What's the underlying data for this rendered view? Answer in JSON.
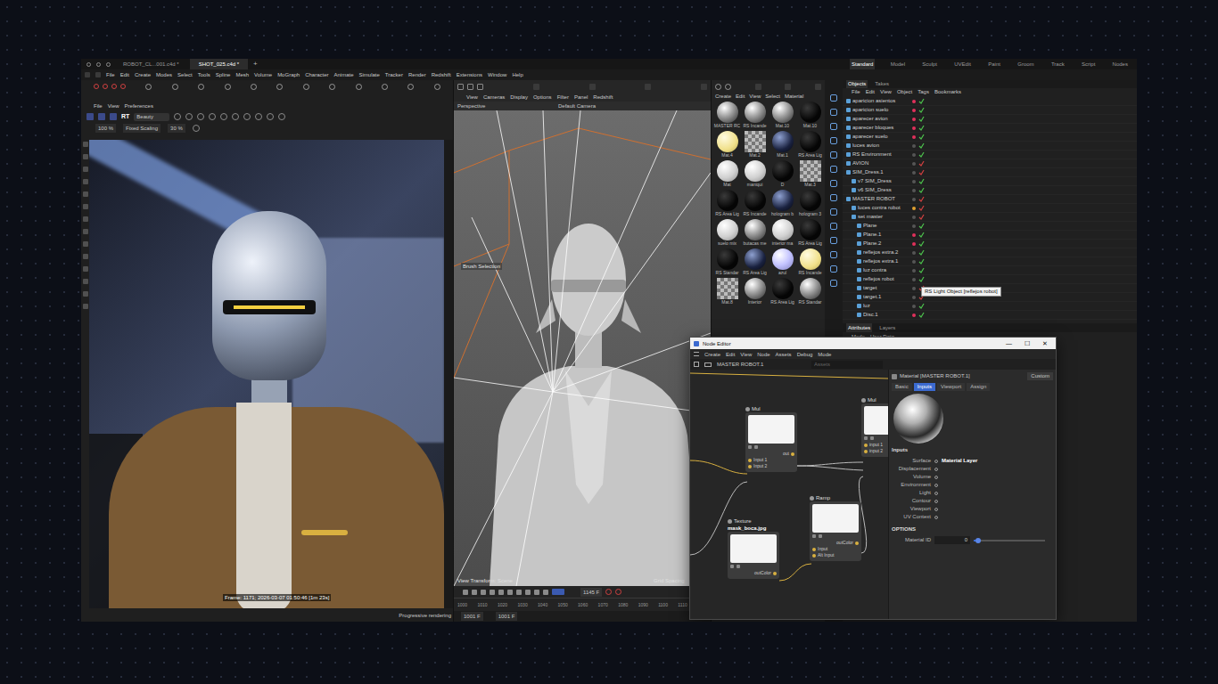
{
  "file_tabs": [
    {
      "label": "ROBOT_CL...001.c4d *",
      "selected": false
    },
    {
      "label": "SHOT_025.c4d *",
      "selected": true
    }
  ],
  "new_tab": "+",
  "layouts": [
    {
      "label": "Standard",
      "selected": true
    },
    {
      "label": "Model",
      "selected": false
    },
    {
      "label": "Sculpt",
      "selected": false
    },
    {
      "label": "UVEdit",
      "selected": false
    },
    {
      "label": "Paint",
      "selected": false
    },
    {
      "label": "Groom",
      "selected": false
    },
    {
      "label": "Track",
      "selected": false
    },
    {
      "label": "Script",
      "selected": false
    },
    {
      "label": "Nodes",
      "selected": false
    }
  ],
  "menu": [
    "File",
    "Edit",
    "Create",
    "Modes",
    "Select",
    "Tools",
    "Spline",
    "Mesh",
    "Volume",
    "MoGraph",
    "Character",
    "Animate",
    "Simulate",
    "Tracker",
    "Render",
    "Redshift",
    "Extensions",
    "Window",
    "Help"
  ],
  "picture_viewer": {
    "menu": [
      "File",
      "View",
      "Preferences"
    ],
    "rt": "RT",
    "pass": "Beauty",
    "zoom": "100 %",
    "scaling": "Fixed Scaling",
    "ratio": "30 %",
    "frame_info": "Frame: 1171; 2026-03-07 01:50:46 [1m 23s]",
    "status": "Progressive rendering"
  },
  "viewport": {
    "menu": [
      "View",
      "Cameras",
      "Display",
      "Options",
      "Filter",
      "Panel",
      "Redshift"
    ],
    "name": "Perspective",
    "camera": "Default Camera",
    "tool": "Brush Selection",
    "view_transform": "View Transform: Scene",
    "grid": "Grid Spacing"
  },
  "timeline": {
    "current": "1145 F",
    "ticks": [
      "1000",
      "1010",
      "1020",
      "1030",
      "1040",
      "1050",
      "1060",
      "1070",
      "1080",
      "1090",
      "1100",
      "1110",
      "1120"
    ],
    "start": "1001 F",
    "end": "1001 F"
  },
  "materials": {
    "menu": [
      "Create",
      "Edit",
      "View",
      "Select",
      "Material"
    ],
    "items": [
      {
        "name": "MASTER RC",
        "kind": "chrome"
      },
      {
        "name": "RS Incande",
        "kind": "chrome"
      },
      {
        "name": "Mat.10",
        "kind": "chrome"
      },
      {
        "name": "Mat.10",
        "kind": "dark"
      },
      {
        "name": "Mat.4",
        "kind": "yellow"
      },
      {
        "name": "Mat.2",
        "kind": "checker"
      },
      {
        "name": "Mat.1",
        "kind": "glass"
      },
      {
        "name": "RS Area Lig",
        "kind": "dark"
      },
      {
        "name": "Mat",
        "kind": "white"
      },
      {
        "name": "maniqui",
        "kind": "white"
      },
      {
        "name": "D",
        "kind": "dark"
      },
      {
        "name": "Mat.3",
        "kind": "checker"
      },
      {
        "name": "RS Area Lig",
        "kind": "dark"
      },
      {
        "name": "RS Incande",
        "kind": "dark"
      },
      {
        "name": "hologram b",
        "kind": "glass"
      },
      {
        "name": "hologram 3",
        "kind": "dark"
      },
      {
        "name": "suelo mix",
        "kind": "white"
      },
      {
        "name": "butacas me",
        "kind": "chrome"
      },
      {
        "name": "interior ma",
        "kind": "white"
      },
      {
        "name": "RS Area Lig",
        "kind": "dark"
      },
      {
        "name": "RS Standar",
        "kind": "dark"
      },
      {
        "name": "RS Area Lig",
        "kind": "glass"
      },
      {
        "name": "azul",
        "kind": "blue"
      },
      {
        "name": "RS Incande",
        "kind": "yellow"
      },
      {
        "name": "Mat.8",
        "kind": "checker"
      },
      {
        "name": "Interior",
        "kind": "chrome"
      },
      {
        "name": "RS Area Lig",
        "kind": "dark"
      },
      {
        "name": "RS Standar",
        "kind": "chrome"
      }
    ]
  },
  "objects": {
    "tabs": [
      {
        "label": "Objects",
        "selected": true
      },
      {
        "label": "Takes",
        "selected": false
      }
    ],
    "menu": [
      "File",
      "Edit",
      "View",
      "Object",
      "Tags",
      "Bookmarks"
    ],
    "items": [
      {
        "name": "aparicion asientos",
        "depth": 0,
        "color": "#e0305a",
        "enabled": true
      },
      {
        "name": "aparicion suelo",
        "depth": 0,
        "color": "#e0305a",
        "enabled": true
      },
      {
        "name": "aparecer avion",
        "depth": 0,
        "color": "#e0305a",
        "enabled": true
      },
      {
        "name": "aparecer bloques",
        "depth": 0,
        "color": "#e0305a",
        "enabled": true
      },
      {
        "name": "aparecer suelo",
        "depth": 0,
        "color": "#e0305a",
        "enabled": true
      },
      {
        "name": "luces avion",
        "depth": 0,
        "color": "#555555",
        "enabled": true
      },
      {
        "name": "RS Environment",
        "depth": 0,
        "color": "#555555",
        "enabled": true
      },
      {
        "name": "AVION",
        "depth": 0,
        "color": "#555555",
        "enabled": false
      },
      {
        "name": "SIM_Dress.1",
        "depth": 0,
        "color": "#555555",
        "enabled": false
      },
      {
        "name": "v7 SIM_Dress",
        "depth": 1,
        "color": "#555555",
        "enabled": true
      },
      {
        "name": "v6 SIM_Dress",
        "depth": 1,
        "color": "#555555",
        "enabled": true
      },
      {
        "name": "MASTER ROBOT",
        "depth": 0,
        "color": "#555555",
        "enabled": false
      },
      {
        "name": "luces contra robot",
        "depth": 1,
        "color": "#e0a030",
        "enabled": false
      },
      {
        "name": "set master",
        "depth": 1,
        "color": "#555555",
        "enabled": false
      },
      {
        "name": "Plane",
        "depth": 2,
        "color": "#555555",
        "enabled": true
      },
      {
        "name": "Plane.1",
        "depth": 2,
        "color": "#e0305a",
        "enabled": true
      },
      {
        "name": "Plane.2",
        "depth": 2,
        "color": "#e0305a",
        "enabled": true
      },
      {
        "name": "reflejos extra.2",
        "depth": 2,
        "color": "#555555",
        "enabled": true
      },
      {
        "name": "reflejos extra.1",
        "depth": 2,
        "color": "#555555",
        "enabled": true
      },
      {
        "name": "luz contra",
        "depth": 2,
        "color": "#555555",
        "enabled": true
      },
      {
        "name": "reflejos robot",
        "depth": 2,
        "color": "#555555",
        "enabled": true
      },
      {
        "name": "target",
        "depth": 2,
        "color": "#555555",
        "enabled": false
      },
      {
        "name": "target.1",
        "depth": 2,
        "color": "#555555",
        "enabled": false
      },
      {
        "name": "luz",
        "depth": 2,
        "color": "#555555",
        "enabled": true
      },
      {
        "name": "Disc.1",
        "depth": 2,
        "color": "#e0305a",
        "enabled": true
      }
    ],
    "tooltip": "RS Light Object [reflejos robot]"
  },
  "attributes": {
    "tabs": [
      {
        "label": "Attributes",
        "selected": true
      },
      {
        "label": "Layers",
        "selected": false
      }
    ],
    "menu": [
      "Mode",
      "User Data"
    ]
  },
  "node_editor": {
    "title": "Node Editor",
    "controls": [
      "—",
      "☐",
      "✕"
    ],
    "menu": [
      "Create",
      "Edit",
      "View",
      "Node",
      "Assets",
      "Debug",
      "Mode"
    ],
    "path": "MASTER ROBOT.1",
    "search": {
      "placeholder": "Assets"
    },
    "nodes": [
      {
        "title": "Mul",
        "inputs": [
          "Input 1",
          "Input 2"
        ],
        "outputs": [
          "out"
        ]
      },
      {
        "title": "Mul",
        "inputs": [
          "input 1",
          "input 2"
        ],
        "outputs": []
      },
      {
        "title": "Texture",
        "subtitle": "mask_boca.jpg",
        "inputs": [],
        "outputs": [
          "outColor"
        ]
      },
      {
        "title": "Ramp",
        "inputs": [
          "Input",
          "Alt Input"
        ],
        "outputs": [
          "outColor"
        ]
      }
    ],
    "inspector": {
      "title": "Material [MASTER ROBOT.1]",
      "preset": "Custom",
      "tabs": [
        {
          "label": "Basic",
          "selected": false
        },
        {
          "label": "Inputs",
          "selected": true
        },
        {
          "label": "Viewport",
          "selected": false
        },
        {
          "label": "Assign",
          "selected": false
        }
      ],
      "section": "Inputs",
      "inputs": [
        {
          "label": "Surface",
          "value": "Material Layer"
        },
        {
          "label": "Displacement"
        },
        {
          "label": "Volume"
        },
        {
          "label": "Environment"
        },
        {
          "label": "Light"
        },
        {
          "label": "Contour"
        },
        {
          "label": "Viewport"
        },
        {
          "label": "UV Context"
        }
      ],
      "options_header": "OPTIONS",
      "material_id_label": "Material ID",
      "material_id": "0",
      "material_id_level": 0.02
    }
  }
}
